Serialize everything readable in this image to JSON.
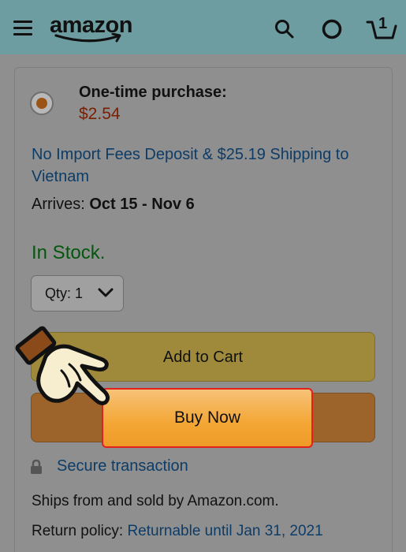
{
  "header": {
    "logo": "amazon",
    "cart_count": "1"
  },
  "purchase": {
    "title": "One-time purchase:",
    "price": "$2.54",
    "shipping_link": "No Import Fees Deposit & $25.19 Shipping to Vietnam",
    "arrives_label": "Arrives: ",
    "arrives_dates": "Oct 15 - Nov 6",
    "stock": "In Stock.",
    "qty_label": "Qty: 1"
  },
  "buttons": {
    "add_to_cart": "Add to Cart",
    "buy_now": "Buy Now"
  },
  "footer": {
    "secure": "Secure transaction",
    "ships": "Ships from and sold by Amazon.com.",
    "return_label": "Return policy: ",
    "return_link": "Returnable until Jan 31, 2021"
  },
  "colors": {
    "header_bg": "#6d9da0",
    "overlay_bg": "#8f8f8f",
    "price": "#7a1f00",
    "link": "#0d3c67",
    "stock": "#04570d",
    "buy_now": "#f3a634",
    "highlight_border": "#e1211b"
  },
  "icons": [
    "menu-icon",
    "search-icon",
    "alexa-icon",
    "cart-icon",
    "lock-icon",
    "chevron-down-icon",
    "pointing-hand-icon"
  ]
}
